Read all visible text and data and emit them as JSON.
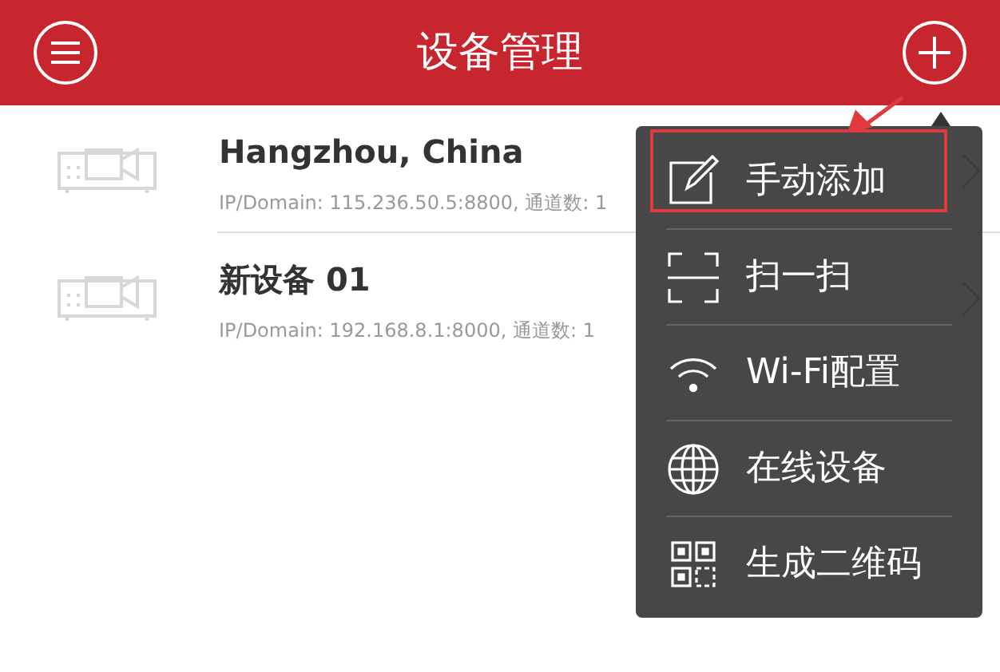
{
  "header": {
    "title": "设备管理"
  },
  "devices": [
    {
      "name": "Hangzhou, China",
      "details": "IP/Domain: 115.236.50.5:8800, 通道数: 1"
    },
    {
      "name": "新设备 01",
      "details": "IP/Domain: 192.168.8.1:8000, 通道数: 1"
    }
  ],
  "menu": [
    {
      "kind": "edit",
      "label": "手动添加"
    },
    {
      "kind": "scan",
      "label": "扫一扫"
    },
    {
      "kind": "wifi",
      "label": "Wi-Fi配置"
    },
    {
      "kind": "globe",
      "label": "在线设备"
    },
    {
      "kind": "qr",
      "label": "生成二维码"
    }
  ]
}
